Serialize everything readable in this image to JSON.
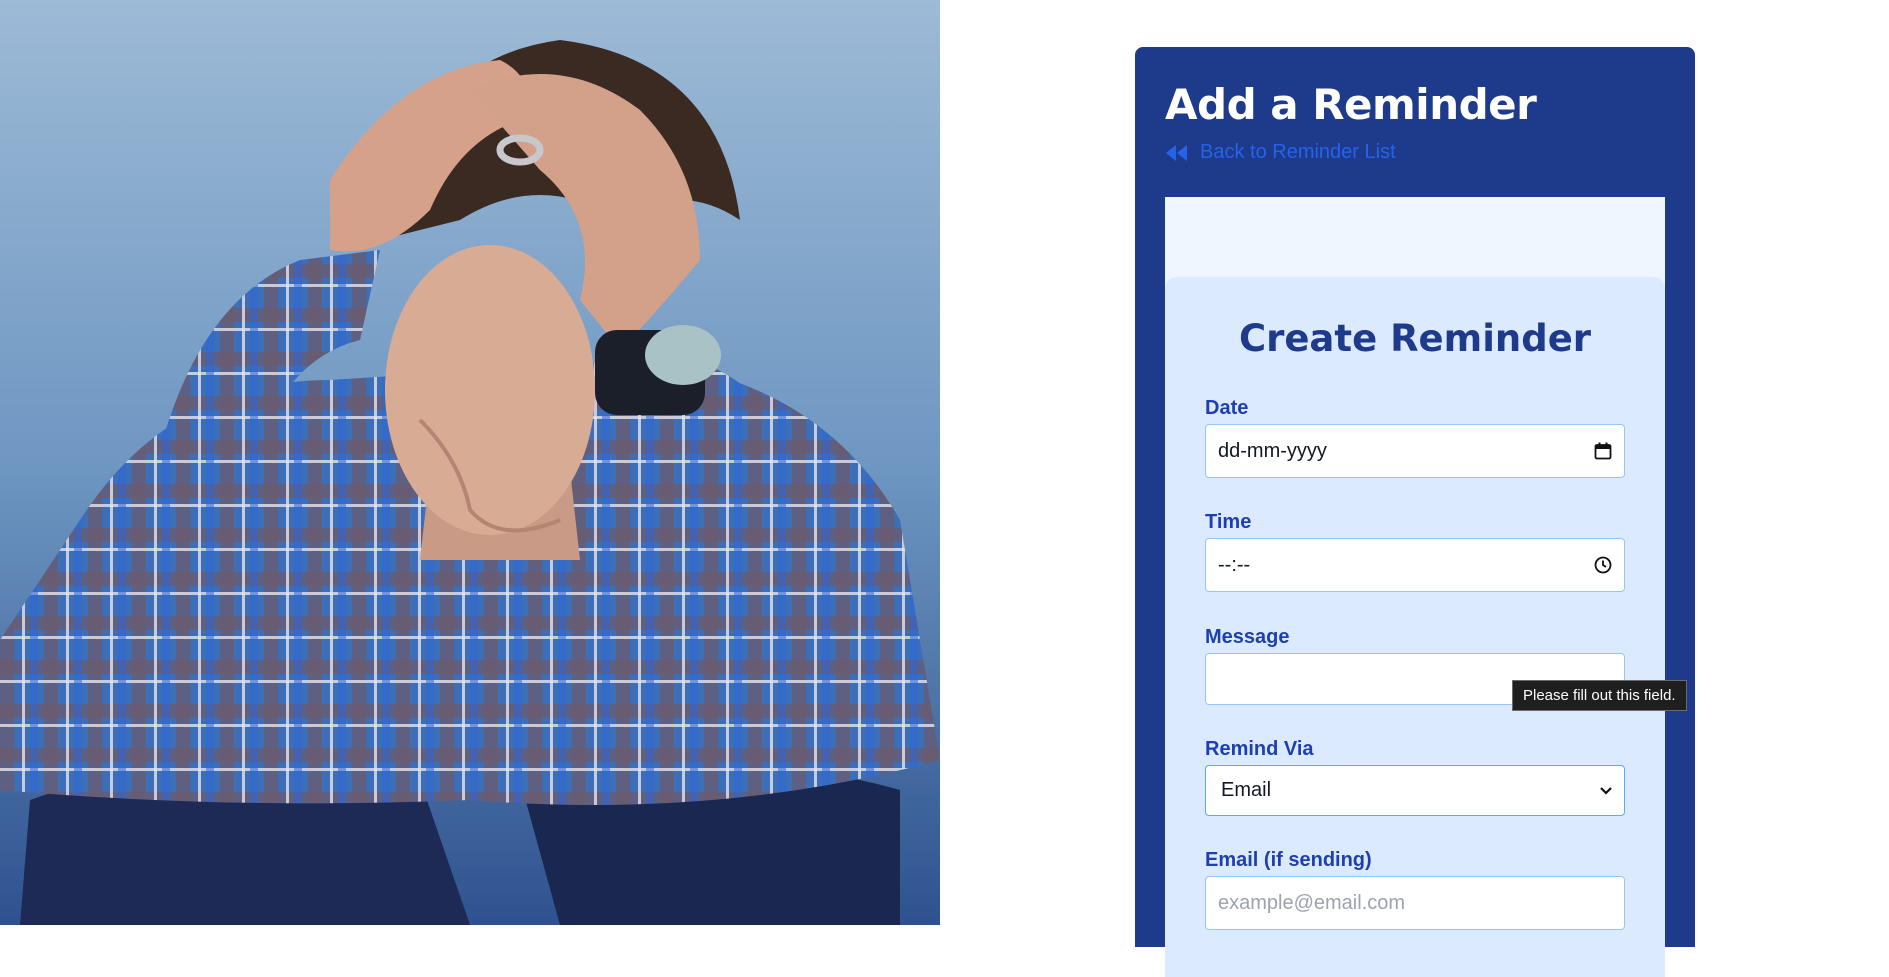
{
  "header": {
    "title": "Add a Reminder",
    "back_link": "Back to Reminder List"
  },
  "form": {
    "title": "Create Reminder",
    "date": {
      "label": "Date",
      "value": "dd-mm-yyyy"
    },
    "time": {
      "label": "Time",
      "value": "--:--"
    },
    "message": {
      "label": "Message",
      "value": ""
    },
    "remind_via": {
      "label": "Remind Via",
      "selected": "Email"
    },
    "email": {
      "label": "Email (if sending)",
      "placeholder": "example@email.com"
    }
  },
  "tooltip": {
    "text": "Please fill out this field."
  },
  "colors": {
    "card": "#1e3a8a",
    "link": "#2563eb",
    "form_bg": "#dbeafe",
    "label": "#1e40af"
  },
  "icons": {
    "back": "double-chevron-left-icon",
    "calendar": "calendar-icon",
    "clock": "clock-icon",
    "dropdown": "chevron-down-icon"
  }
}
